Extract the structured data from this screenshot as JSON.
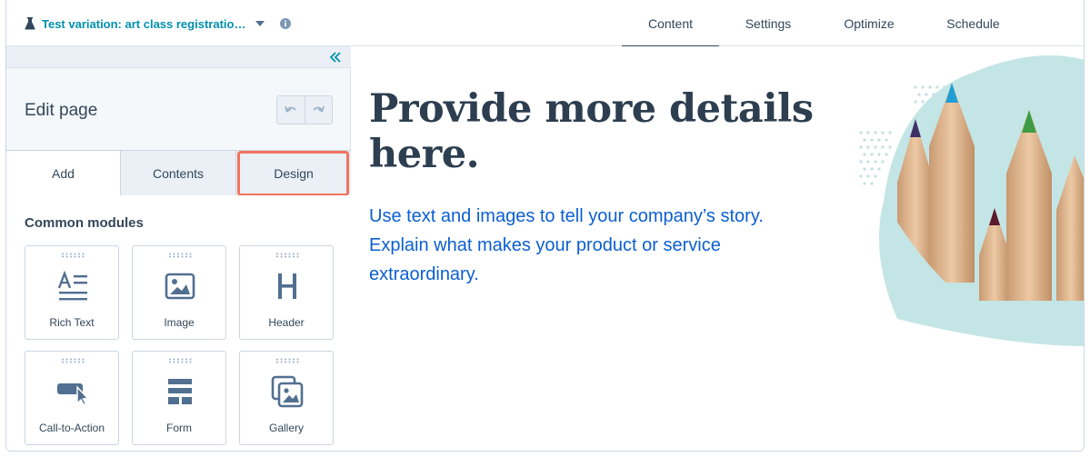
{
  "header": {
    "variation_title": "Test variation: art class registratio…",
    "tabs": [
      {
        "label": "Content",
        "active": true
      },
      {
        "label": "Settings",
        "active": false
      },
      {
        "label": "Optimize",
        "active": false
      },
      {
        "label": "Schedule",
        "active": false
      }
    ]
  },
  "sidebar": {
    "title": "Edit page",
    "tabs": [
      {
        "label": "Add",
        "active": true
      },
      {
        "label": "Contents",
        "active": false
      },
      {
        "label": "Design",
        "active": false,
        "highlighted": true
      }
    ],
    "section_title": "Common modules",
    "modules": [
      {
        "label": "Rich Text",
        "icon": "rich-text-icon"
      },
      {
        "label": "Image",
        "icon": "image-icon"
      },
      {
        "label": "Header",
        "icon": "header-icon"
      },
      {
        "label": "Call-to-Action",
        "icon": "cta-icon"
      },
      {
        "label": "Form",
        "icon": "form-icon"
      },
      {
        "label": "Gallery",
        "icon": "gallery-icon"
      }
    ]
  },
  "preview": {
    "headline": "Provide more details here.",
    "body": "Use text and images to tell your company’s story. Explain what makes your product or service extraordinary."
  },
  "colors": {
    "accent": "#0091ae",
    "highlight_border": "#f2735e",
    "body_link": "#0b5fd1",
    "text": "#33475b"
  }
}
